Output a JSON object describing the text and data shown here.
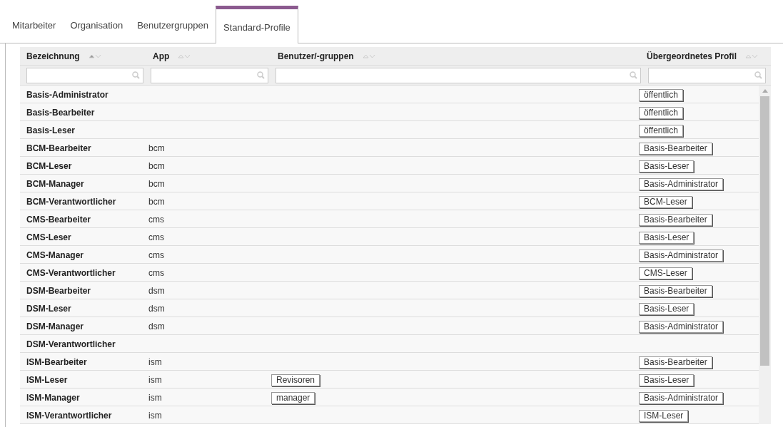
{
  "tabs": [
    {
      "label": "Mitarbeiter",
      "selected": false
    },
    {
      "label": "Organisation",
      "selected": false
    },
    {
      "label": "Benutzergruppen",
      "selected": false
    },
    {
      "label": "Standard-Profile",
      "selected": true
    }
  ],
  "table": {
    "columns": [
      {
        "label": "Bezeichnung",
        "sorted": true
      },
      {
        "label": "App",
        "sorted": false
      },
      {
        "label": "Benutzer/-gruppen",
        "sorted": false
      },
      {
        "label": "Übergeordnetes Profil",
        "sorted": false
      }
    ],
    "rows": [
      {
        "name": "Basis-Administrator",
        "parent": "öffentlich"
      },
      {
        "name": "Basis-Bearbeiter",
        "parent": "öffentlich"
      },
      {
        "name": "Basis-Leser",
        "parent": "öffentlich"
      },
      {
        "name": "BCM-Bearbeiter",
        "app": "bcm",
        "parent": "Basis-Bearbeiter"
      },
      {
        "name": "BCM-Leser",
        "app": "bcm",
        "parent": "Basis-Leser"
      },
      {
        "name": "BCM-Manager",
        "app": "bcm",
        "parent": "Basis-Administrator"
      },
      {
        "name": "BCM-Verantwortlicher",
        "app": "bcm",
        "parent": "BCM-Leser"
      },
      {
        "name": "CMS-Bearbeiter",
        "app": "cms",
        "parent": "Basis-Bearbeiter"
      },
      {
        "name": "CMS-Leser",
        "app": "cms",
        "parent": "Basis-Leser"
      },
      {
        "name": "CMS-Manager",
        "app": "cms",
        "parent": "Basis-Administrator"
      },
      {
        "name": "CMS-Verantwortlicher",
        "app": "cms",
        "parent": "CMS-Leser"
      },
      {
        "name": "DSM-Bearbeiter",
        "app": "dsm",
        "parent": "Basis-Bearbeiter"
      },
      {
        "name": "DSM-Leser",
        "app": "dsm",
        "parent": "Basis-Leser"
      },
      {
        "name": "DSM-Manager",
        "app": "dsm",
        "parent": "Basis-Administrator"
      },
      {
        "name": "DSM-Verantwortlicher"
      },
      {
        "name": "ISM-Bearbeiter",
        "app": "ism",
        "parent": "Basis-Bearbeiter"
      },
      {
        "name": "ISM-Leser",
        "app": "ism",
        "users": "Revisoren",
        "parent": "Basis-Leser"
      },
      {
        "name": "ISM-Manager",
        "app": "ism",
        "users": "manager",
        "parent": "Basis-Administrator"
      },
      {
        "name": "ISM-Verantwortlicher",
        "app": "ism",
        "parent": "ISM-Leser"
      }
    ]
  }
}
